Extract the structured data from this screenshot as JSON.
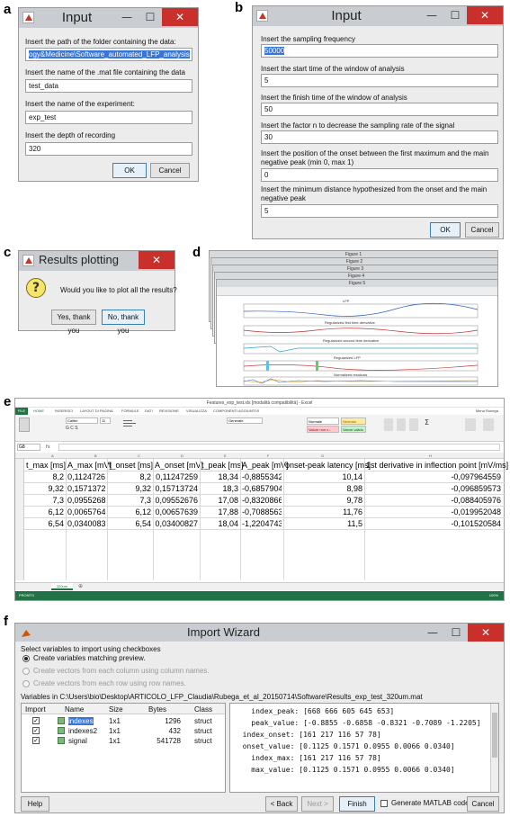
{
  "panel_labels": {
    "a": "a",
    "b": "b",
    "c": "c",
    "d": "d",
    "e": "e",
    "f": "f"
  },
  "win_a": {
    "title": "Input",
    "rows": [
      {
        "label": "Insert the path of the folder containing the data:",
        "value": "ogy&Medicine\\Software_automated_LFP_analysis",
        "selected": true
      },
      {
        "label": "Insert the name of the .mat file containing the data",
        "value": "test_data"
      },
      {
        "label": "Insert the name of the experiment:",
        "value": "exp_test"
      },
      {
        "label": "Insert the depth of recording",
        "value": "320"
      }
    ],
    "ok": "OK",
    "cancel": "Cancel"
  },
  "win_b": {
    "title": "Input",
    "rows": [
      {
        "label": "Insert the sampling frequency",
        "value": "50000",
        "selected": true
      },
      {
        "label": "Insert the start time of the window of analysis",
        "value": "5"
      },
      {
        "label": "Insert the finish time of the window of analysis",
        "value": "50"
      },
      {
        "label": "Insert the factor n to decrease the sampling rate of the signal",
        "value": "30"
      },
      {
        "label": "Insert the position of the onset between the first maximum and the main negative peak (min 0, max 1)",
        "value": "0"
      },
      {
        "label": "Insert the minimum distance hypothesized from the onset and the main negative peak",
        "value": "5"
      }
    ],
    "ok": "OK",
    "cancel": "Cancel"
  },
  "win_c": {
    "title": "Results plotting",
    "question": "Would you like to plot all the results?",
    "yes": "Yes, thank you",
    "no": "No, thank you",
    "icon": "question-icon"
  },
  "win_d": {
    "figures": [
      "Figure 1",
      "Figure 2",
      "Figure 3",
      "Figure 4",
      "Figure 5"
    ],
    "plot_titles": [
      "LFP",
      "Regularized first time derivative",
      "Regularized second time derivative",
      "Regularized LFP",
      "Normalized residuals"
    ],
    "xlabel": "time [ms]"
  },
  "excel": {
    "title": "Features_exp_test.xls [modalità compatibilità] - Excel",
    "user": "Mena Rubega",
    "ribbon_tabs": [
      "FILE",
      "HOME",
      "INSERISCI",
      "LAYOUT DI PAGINA",
      "FORMULE",
      "DATI",
      "REVISIONE",
      "VISUALIZZA",
      "COMPONENTI AGGIUNTIVI"
    ],
    "font": "Calibri",
    "font_size": "11",
    "number_format": "Generale",
    "styles": {
      "normale": "Normale",
      "neutrale": "Neutrale",
      "valore_non": "Valore non v...",
      "valore_valido": "Valore valido"
    },
    "name_box": "G8",
    "col_letters": [
      "A",
      "B",
      "C",
      "D",
      "E",
      "F",
      "G",
      "H"
    ],
    "headers": [
      "t_max [ms]",
      "A_max [mV]",
      "t_onset [ms]",
      "A_onset [mV]",
      "t_peak [ms]",
      "A_peak [mV]",
      "onset-peak latency [ms]",
      "1st derivative in inflection point [mV/ms]"
    ],
    "rows": [
      [
        "8,2",
        "0,1124726",
        "8,2",
        "0,11247259",
        "18,34",
        "-0,8855342",
        "10,14",
        "-0,097964559"
      ],
      [
        "9,32",
        "0,1571372",
        "9,32",
        "0,15713724",
        "18,3",
        "-0,6857904",
        "8,98",
        "-0,096859573"
      ],
      [
        "7,3",
        "0,0955268",
        "7,3",
        "0,09552676",
        "17,08",
        "-0,8320866",
        "9,78",
        "-0,088405976"
      ],
      [
        "6,12",
        "0,0065764",
        "6,12",
        "0,00657639",
        "17,88",
        "-0,7088563",
        "11,76",
        "-0,019952048"
      ],
      [
        "6,54",
        "0,0340083",
        "6,54",
        "0,03400827",
        "18,04",
        "-1,2204743",
        "11,5",
        "-0,101520584"
      ]
    ],
    "sheet_tab": "320um",
    "status": "PRONTO",
    "zoom": "100%"
  },
  "wizard": {
    "title": "Import Wizard",
    "select_text": "Select variables to import using checkboxes",
    "radio1": "Create variables matching preview.",
    "radio2": "Create vectors from each column using column names.",
    "radio3": "Create vectors from each row using row names.",
    "path": "Variables in C:\\Users\\bio\\Desktop\\ARTICOLO_LFP_Claudia\\Rubega_et_al_20150714\\Software\\Results_exp_test_320um.mat",
    "columns": [
      "Import",
      "Name",
      "Size",
      "Bytes",
      "Class"
    ],
    "vars": [
      {
        "name": "indexes",
        "size": "1x1",
        "bytes": "1296",
        "class": "struct"
      },
      {
        "name": "indexes2",
        "size": "1x1",
        "bytes": "432",
        "class": "struct"
      },
      {
        "name": "signal",
        "size": "1x1",
        "bytes": "541728",
        "class": "struct"
      }
    ],
    "preview": [
      "    index_peak: [668 666 605 645 653]",
      "    peak_value: [-0.8855 -0.6858 -0.8321 -0.7089 -1.2205]",
      "  index_onset: [161 217 116 57 78]",
      "  onset_value: [0.1125 0.1571 0.0955 0.0066 0.0340]",
      "    index_max: [161 217 116 57 78]",
      "    max_value: [0.1125 0.1571 0.0955 0.0066 0.0340]"
    ],
    "help": "Help",
    "back": "< Back",
    "next": "Next >",
    "finish": "Finish",
    "gen": "Generate MATLAB code",
    "cancel": "Cancel"
  }
}
